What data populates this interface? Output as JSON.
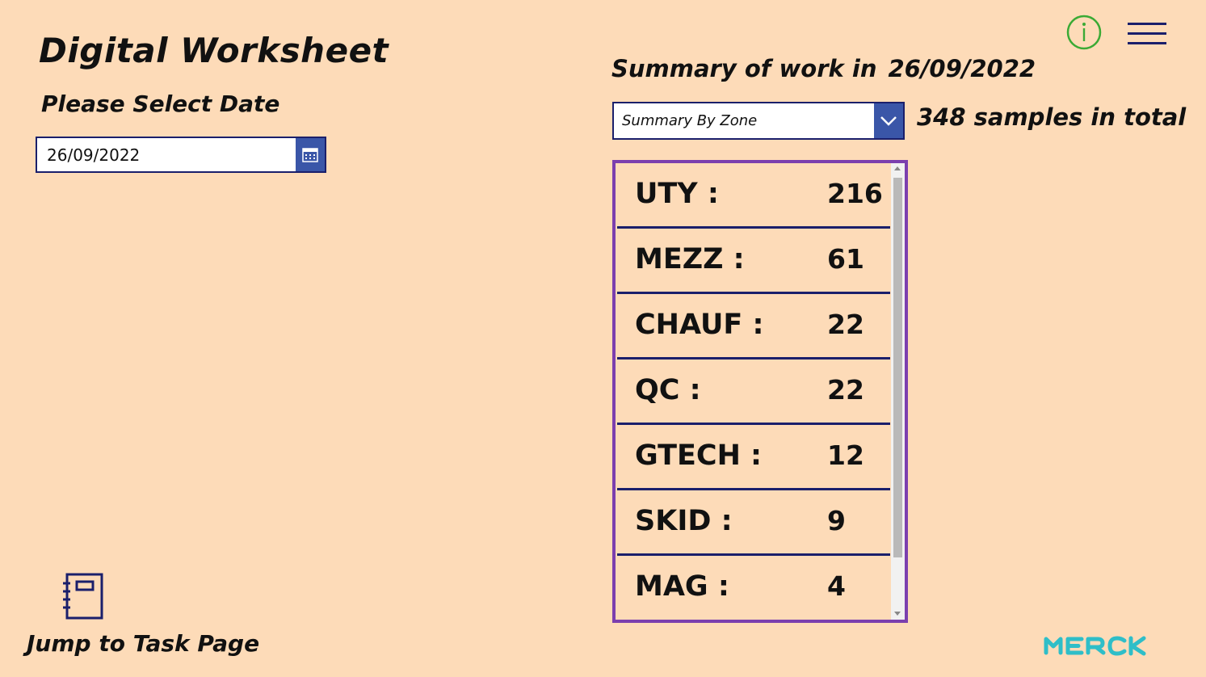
{
  "app": {
    "title": "Digital Worksheet",
    "date_prompt": "Please Select Date"
  },
  "date_picker": {
    "value": "26/09/2022",
    "icon": "calendar-icon"
  },
  "summary": {
    "heading_prefix": "Summary of work in",
    "date": "26/09/2022",
    "mode": "Summary By Zone",
    "total_text": "348 samples in total"
  },
  "zones": [
    {
      "label": "UTY :",
      "count": "216"
    },
    {
      "label": "MEZZ :",
      "count": "61"
    },
    {
      "label": "CHAUF :",
      "count": "22"
    },
    {
      "label": "QC :",
      "count": "22"
    },
    {
      "label": "GTECH :",
      "count": "12"
    },
    {
      "label": "SKID :",
      "count": "9"
    },
    {
      "label": "MAG :",
      "count": "4"
    }
  ],
  "nav": {
    "jump_label": "Jump to Task Page",
    "info_icon": "info-icon",
    "menu_icon": "hamburger-menu-icon"
  },
  "brand": {
    "logo_text": "MERCK",
    "logo_color": "#2FBEC8",
    "accent": "#3A56A8",
    "border": "#1A1F6B",
    "gallery_border": "#7B3FAE",
    "background": "#FDDBB8",
    "info_color": "#3BAA35"
  }
}
